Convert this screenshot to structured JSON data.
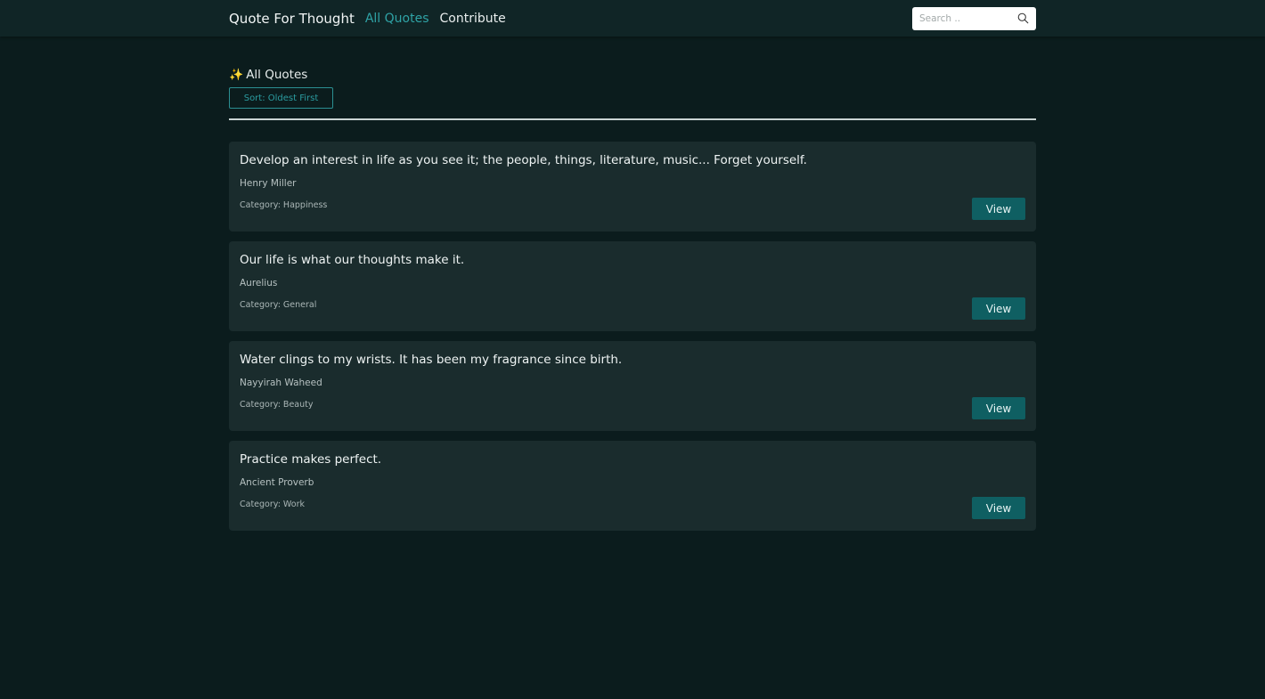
{
  "nav": {
    "brand": "Quote For Thought",
    "links": [
      {
        "label": "All Quotes",
        "active": true
      },
      {
        "label": "Contribute",
        "active": false
      }
    ],
    "search_placeholder": "Search ..",
    "search_icon": "search-icon"
  },
  "page": {
    "title_icon": "✨",
    "title": "All Quotes",
    "sort_label": "Sort: Oldest First"
  },
  "quotes": [
    {
      "text": "Develop an interest in life as you see it; the people, things, literature, music... Forget yourself.",
      "author": "Henry Miller",
      "category": "Category: Happiness",
      "action": "View"
    },
    {
      "text": "Our life is what our thoughts make it.",
      "author": "Aurelius",
      "category": "Category: General",
      "action": "View"
    },
    {
      "text": "Water clings to my wrists. It has been my fragrance since birth.",
      "author": "Nayyirah Waheed",
      "category": "Category: Beauty",
      "action": "View"
    },
    {
      "text": "Practice makes perfect.",
      "author": "Ancient Proverb",
      "category": "Category: Work",
      "action": "View"
    }
  ],
  "colors": {
    "background": "#0b1c1d",
    "navbar": "#102526",
    "accent": "#2fa3a6",
    "card": "#1a2c2d",
    "button": "#0f5f62"
  }
}
